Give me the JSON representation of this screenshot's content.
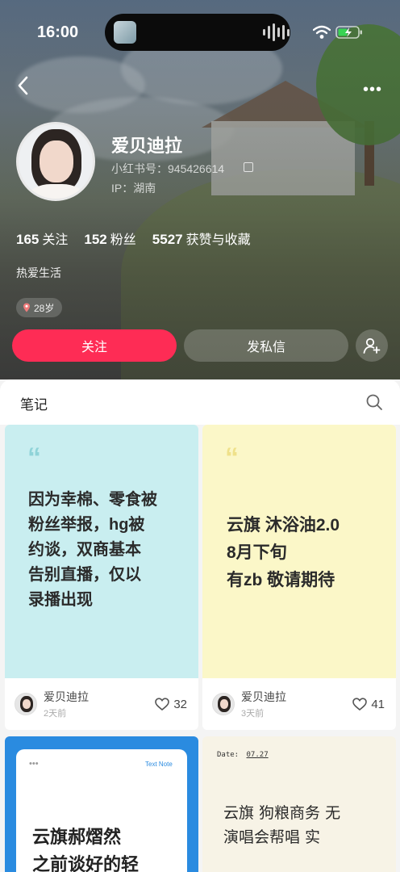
{
  "status_bar": {
    "time": "16:00"
  },
  "profile": {
    "name": "爱贝迪拉",
    "red_id": "小红书号：945426614",
    "ip": "IP：湖南",
    "stats": [
      {
        "value": "165",
        "label": "关注"
      },
      {
        "value": "152",
        "label": "粉丝"
      },
      {
        "value": "5527",
        "label": "获赞与收藏"
      }
    ],
    "bio": "热爱生活",
    "age_tag": "28岁",
    "follow_label": "关注",
    "message_label": "发私信"
  },
  "tabs": {
    "notes": "笔记"
  },
  "notes": [
    {
      "cover_lines": [
        "因为幸棉、零食被",
        "粉丝举报，hg被",
        "约谈，双商基本",
        "告别直播，仅以",
        "录播出现"
      ],
      "author": "爱贝迪拉",
      "time": "2天前",
      "likes": "32",
      "bg": "#c9eef0",
      "quote_color": "#8fd3d8"
    },
    {
      "cover_lines": [
        "云旗 沐浴油2.0",
        "8月下旬",
        "有zb 敬请期待"
      ],
      "author": "爱贝迪拉",
      "time": "3天前",
      "likes": "41",
      "bg": "#fbf7c8",
      "quote_color": "#efe18a"
    },
    {
      "cover_lines": [
        "云旗郝熠然",
        "之前谈好的轻"
      ],
      "header_tag": "Text Note",
      "bg": "#2a8be0"
    },
    {
      "cover_lines": [
        "云旗 狗粮商务 无",
        "演唱会帮唱 实"
      ],
      "date_label": "Date:",
      "date_value": "07.27",
      "bg": "#f7f3e6"
    }
  ],
  "colors": {
    "accent": "#fe2c55"
  }
}
